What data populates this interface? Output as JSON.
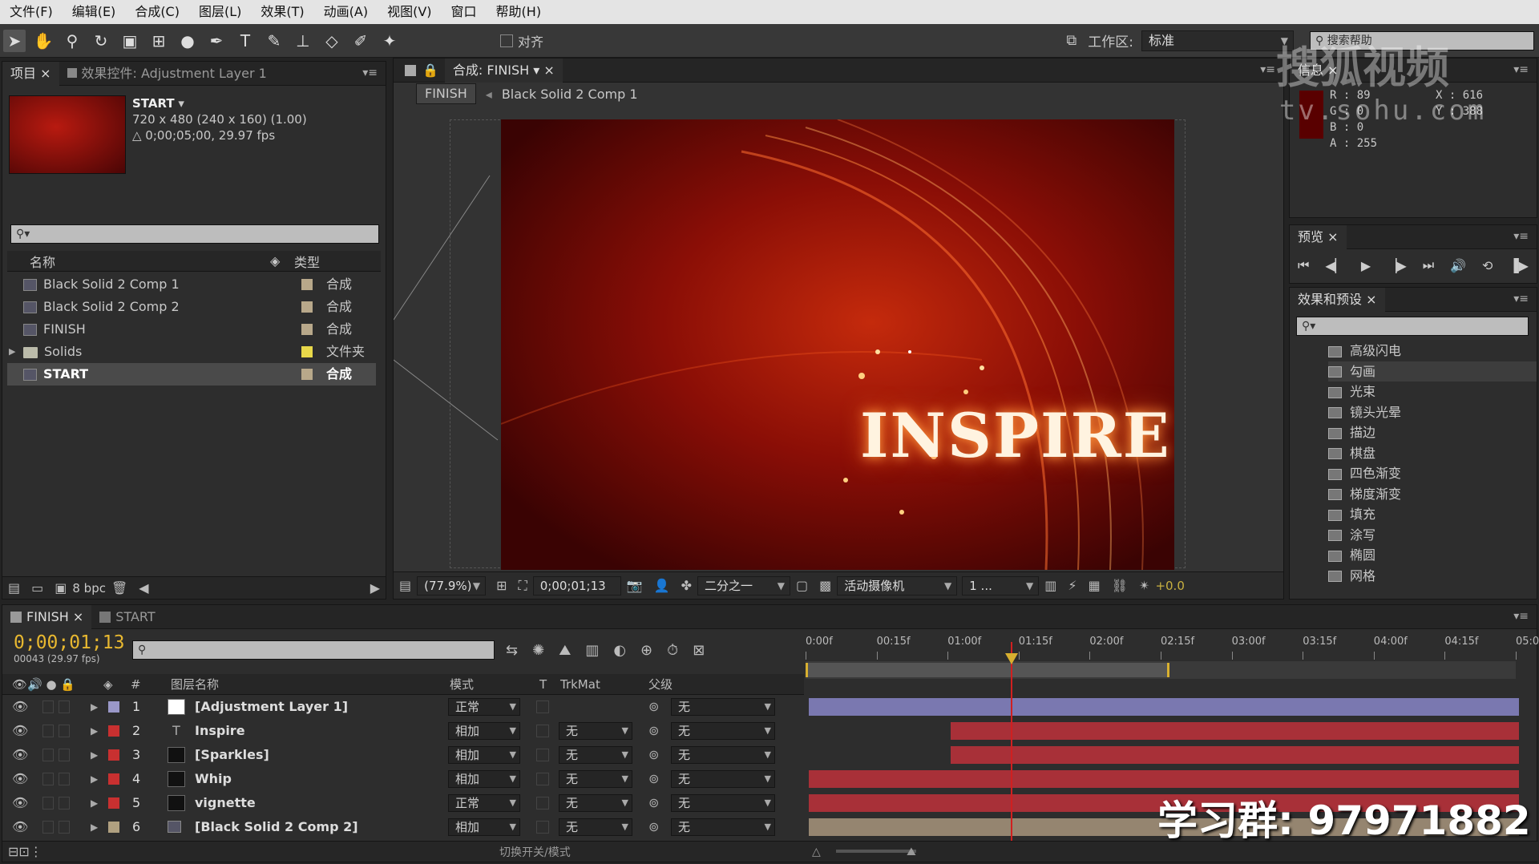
{
  "menu": [
    "文件(F)",
    "编辑(E)",
    "合成(C)",
    "图层(L)",
    "效果(T)",
    "动画(A)",
    "视图(V)",
    "窗口",
    "帮助(H)"
  ],
  "toolbar": {
    "align_label": "对齐",
    "workspace_label": "工作区:",
    "workspace_value": "标准",
    "search_help": "搜索帮助"
  },
  "project": {
    "tabs": [
      "项目",
      "效果控件: Adjustment Layer 1"
    ],
    "selected_name": "START",
    "info_line1": "720 x 480 (240 x 160) (1.00)",
    "info_line2": "△ 0;00;05;00, 29.97 fps",
    "col_name": "名称",
    "col_type": "类型",
    "items": [
      {
        "name": "Black Solid 2 Comp 1",
        "type": "合成",
        "kind": "comp",
        "color": "#b8a88a"
      },
      {
        "name": "Black Solid 2 Comp 2",
        "type": "合成",
        "kind": "comp",
        "color": "#b8a88a"
      },
      {
        "name": "FINISH",
        "type": "合成",
        "kind": "comp",
        "color": "#b8a88a"
      },
      {
        "name": "Solids",
        "type": "文件夹",
        "kind": "folder",
        "color": "#e8d84a"
      },
      {
        "name": "START",
        "type": "合成",
        "kind": "comp",
        "color": "#b8a88a"
      }
    ],
    "bpc": "8 bpc"
  },
  "composition": {
    "tab": "合成: FINISH",
    "crumbs": [
      "FINISH",
      "Black Solid 2 Comp 1"
    ],
    "title_text": "INSPIRE",
    "zoom": "(77.9%)",
    "timecode": "0;00;01;13",
    "resolution": "二分之一",
    "camera": "活动摄像机",
    "views": "1 ...",
    "exposure": "+0.0"
  },
  "info": {
    "tab": "信息",
    "r": "R : 89",
    "g": "G : 0",
    "b": "B : 0",
    "a": "A : 255",
    "x": "X : 616",
    "y": "Y : 388"
  },
  "preview": {
    "tab": "预览"
  },
  "effects": {
    "tab": "效果和预设",
    "items": [
      "高级闪电",
      "勾画",
      "光束",
      "镜头光晕",
      "描边",
      "棋盘",
      "四色渐变",
      "梯度渐变",
      "填充",
      "涂写",
      "椭圆",
      "网格"
    ]
  },
  "timeline": {
    "tabs": [
      "FINISH",
      "START"
    ],
    "timecode": "0;00;01;13",
    "frames": "00043 (29.97 fps)",
    "col_layername": "图层名称",
    "col_mode": "模式",
    "col_t": "T",
    "col_trkmat": "TrkMat",
    "col_parent": "父级",
    "ruler": [
      "0:00f",
      "00:15f",
      "01:00f",
      "01:15f",
      "02:00f",
      "02:15f",
      "03:00f",
      "03:15f",
      "04:00f",
      "04:15f",
      "05:0"
    ],
    "toggle_label": "切换开关/模式",
    "layers": [
      {
        "num": "1",
        "name": "[Adjustment Layer 1]",
        "mode": "正常",
        "trkmat": "",
        "parent": "无",
        "label": "#9a98c8",
        "swatch": "#ffffff",
        "bar": "#7a78b0",
        "start": 0
      },
      {
        "num": "2",
        "name": "Inspire",
        "mode": "相加",
        "trkmat": "无",
        "parent": "无",
        "label": "#c83030",
        "swatch": "text",
        "bar": "#a83038",
        "start": 0.2
      },
      {
        "num": "3",
        "name": "[Sparkles]",
        "mode": "相加",
        "trkmat": "无",
        "parent": "无",
        "label": "#c83030",
        "swatch": "#111111",
        "bar": "#a83038",
        "start": 0.2
      },
      {
        "num": "4",
        "name": "Whip",
        "mode": "相加",
        "trkmat": "无",
        "parent": "无",
        "label": "#c83030",
        "swatch": "#111111",
        "bar": "#a83038",
        "start": 0
      },
      {
        "num": "5",
        "name": "vignette",
        "mode": "正常",
        "trkmat": "无",
        "parent": "无",
        "label": "#c83030",
        "swatch": "#111111",
        "bar": "#a83038",
        "start": 0
      },
      {
        "num": "6",
        "name": "[Black Solid 2 Comp 2]",
        "mode": "相加",
        "trkmat": "无",
        "parent": "无",
        "label": "#b0a080",
        "swatch": "comp",
        "bar": "#958570",
        "start": 0
      }
    ]
  },
  "watermark": {
    "logo": "搜狐视频",
    "url": "tv.sohu.com",
    "group": "学习群: 97971882"
  }
}
